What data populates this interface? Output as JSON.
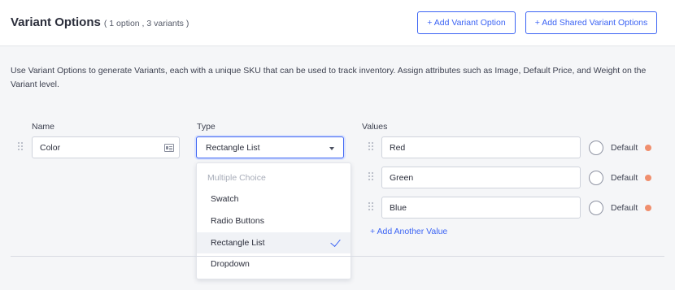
{
  "header": {
    "title": "Variant Options",
    "subtitle": "( 1 option , 3 variants )",
    "add_variant_option_label": "+ Add Variant Option",
    "add_shared_variant_options_label": "+ Add Shared Variant Options"
  },
  "description": "Use Variant Options to generate Variants, each with a unique SKU that can be used to track inventory. Assign attributes such as Image, Default Price, and Weight on the Variant level.",
  "columns": {
    "name": "Name",
    "type": "Type",
    "values": "Values"
  },
  "option": {
    "name_value": "Color",
    "type_selected": "Rectangle List",
    "type_dropdown": {
      "group_label": "Multiple Choice",
      "items": [
        "Swatch",
        "Radio Buttons",
        "Rectangle List",
        "Dropdown"
      ],
      "selected_index": 2
    },
    "values": [
      {
        "value": "Red",
        "default_label": "Default"
      },
      {
        "value": "Green",
        "default_label": "Default"
      },
      {
        "value": "Blue",
        "default_label": "Default"
      }
    ],
    "add_value_label": "+ Add Another Value"
  },
  "colors": {
    "accent": "#3c64f4",
    "remove": "#f08f6e",
    "background": "#f5f6f8"
  },
  "icons": [
    "drag-handle-icon",
    "card-icon",
    "caret-down-icon",
    "check-icon",
    "radio-icon",
    "remove-dot-icon"
  ]
}
